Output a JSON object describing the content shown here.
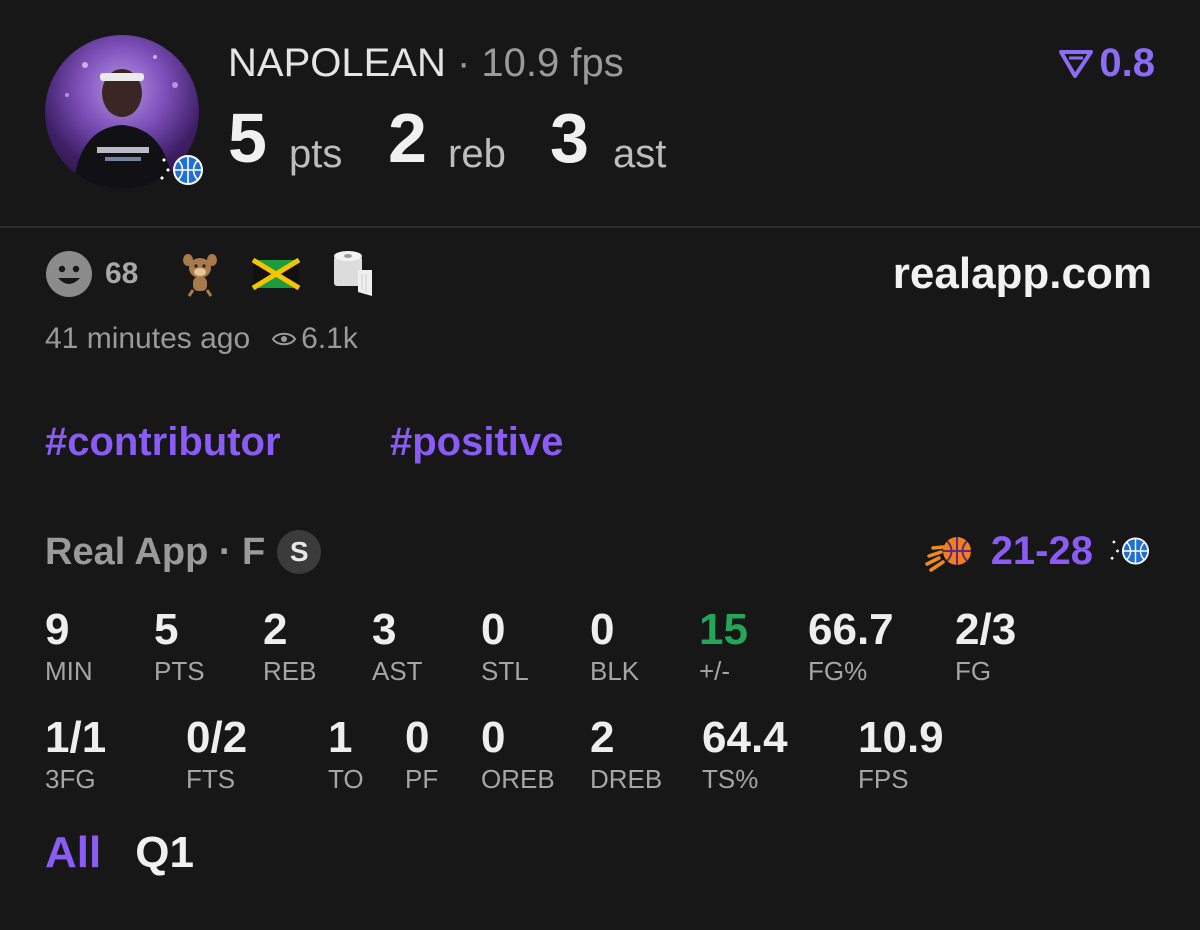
{
  "player": {
    "name": "NAPOLEAN",
    "fps_text": "· 10.9 fps",
    "avatar_icon": "player-photo",
    "team_icon": "magic-basketball-icon"
  },
  "headline": {
    "pts_value": "5",
    "pts_unit": "pts",
    "reb_value": "2",
    "reb_unit": "reb",
    "ast_value": "3",
    "ast_unit": "ast"
  },
  "rating": {
    "icon": "real-logo-icon",
    "value": "0.8",
    "color": "#8a6cf5"
  },
  "reactions": {
    "smiley_count": "68",
    "icons": [
      "smiley-face-icon",
      "cartoon-character-icon",
      "jamaica-flag-icon",
      "toilet-paper-icon"
    ]
  },
  "site": "realapp.com",
  "meta": {
    "time_ago": "41 minutes ago",
    "views": "6.1k"
  },
  "tags": [
    "#contributor",
    "#positive"
  ],
  "game": {
    "label": "Real App · F",
    "badge": "S",
    "score": "21-28",
    "home_icon": "suns-logo-icon",
    "away_icon": "magic-basketball-icon"
  },
  "stats_row1": [
    {
      "value": "9",
      "label": "MIN"
    },
    {
      "value": "5",
      "label": "PTS"
    },
    {
      "value": "2",
      "label": "REB"
    },
    {
      "value": "3",
      "label": "AST"
    },
    {
      "value": "0",
      "label": "STL"
    },
    {
      "value": "0",
      "label": "BLK"
    },
    {
      "value": "15",
      "label": "+/-"
    },
    {
      "value": "66.7",
      "label": "FG%"
    },
    {
      "value": "2/3",
      "label": "FG"
    }
  ],
  "stats_row2": [
    {
      "value": "1/1",
      "label": "3FG"
    },
    {
      "value": "0/2",
      "label": "FTS"
    },
    {
      "value": "1",
      "label": "TO"
    },
    {
      "value": "0",
      "label": "PF"
    },
    {
      "value": "0",
      "label": "OREB"
    },
    {
      "value": "2",
      "label": "DREB"
    },
    {
      "value": "64.4",
      "label": "TS%"
    },
    {
      "value": "10.9",
      "label": "FPS"
    }
  ],
  "periods": {
    "all": "All",
    "q1": "Q1",
    "active": "All"
  },
  "colors": {
    "accent": "#8a5cf5",
    "positive": "#24a55a",
    "background": "#171717"
  }
}
